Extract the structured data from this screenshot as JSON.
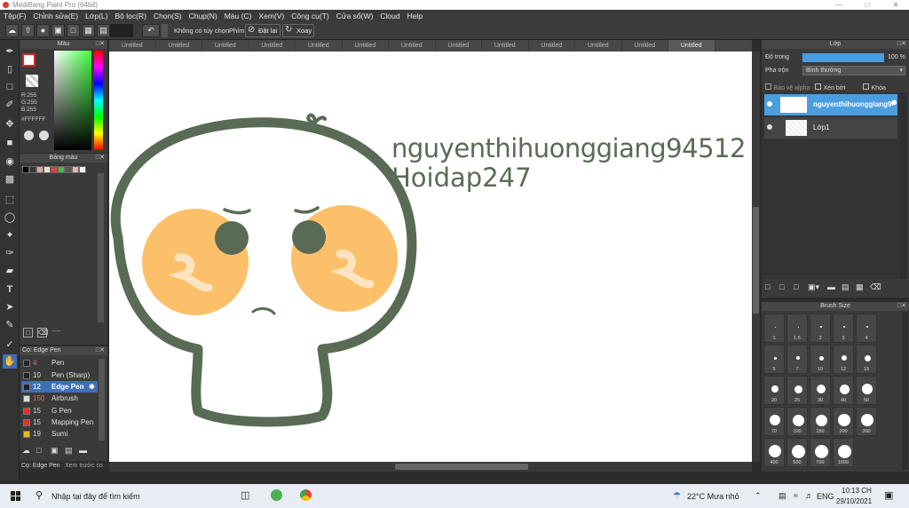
{
  "window": {
    "title": "MediBang Paint Pro (64bit)"
  },
  "menu": [
    "Tệp(F)",
    "Chỉnh sửa(E)",
    "Lớp(L)",
    "Bộ lọc(R)",
    "Chọn(S)",
    "Chụp(N)",
    "Màu (C)",
    "Xem(V)",
    "Công cụ(T)",
    "Cửa sổ(W)",
    "Cloud",
    "Help"
  ],
  "toolbar": {
    "antialias_label": "Không có tùy chọn",
    "key_label": "Phím",
    "reset_label": "Đặt lại",
    "rotate_label": "Xoay"
  },
  "tabs": [
    "Untitled",
    "Untitled",
    "Untitled",
    "Untitled",
    "Untitled",
    "Untitled",
    "Untitled",
    "Untitled",
    "Untitled",
    "Untitled",
    "Untitled",
    "Untitled",
    "Untitled"
  ],
  "color_panel": {
    "title": "Màu",
    "r": "R:255",
    "g": "G:255",
    "b": "B:255",
    "hex": "#FFFFFF"
  },
  "swatch_panel": {
    "title": "Bảng màu",
    "footer": "----"
  },
  "brush_panel": {
    "title": "Cọ: Edge Pen",
    "brushes": [
      {
        "size": "4",
        "name": "Pen",
        "color": "#222222"
      },
      {
        "size": "10",
        "name": "Pen (Sharp)",
        "color": "#222222"
      },
      {
        "size": "12",
        "name": "Edge Pen",
        "color": "#222222",
        "selected": true
      },
      {
        "size": "150",
        "name": "Airbrush",
        "color": "#dddddd"
      },
      {
        "size": "15",
        "name": "G Pen",
        "color": "#e03030"
      },
      {
        "size": "15",
        "name": "Mapping Pen",
        "color": "#e03030"
      },
      {
        "size": "19",
        "name": "Sumi",
        "color": "#e0c020"
      }
    ],
    "tab1": "Cọ: Edge Pen",
    "tab2": "Xem trước co"
  },
  "canvas": {
    "text_line1": "nguyenthihuonggiang94512",
    "text_line2": "Hoidap247",
    "colors": {
      "outline": "#5a6b55",
      "cheek": "#fdc06a",
      "cheek_mark": "#fde4c0",
      "eye": "#5a6b55"
    }
  },
  "layer_panel": {
    "title": "Lớp",
    "opacity_label": "Độ trong",
    "opacity_value": "100 %",
    "opacity": 1.0,
    "blend_label": "Pha trộn",
    "blend_value": "Bình thường",
    "protect_alpha": "Bảo vệ alpha",
    "clipping": "Xén bớt",
    "lock": "Khóa",
    "layers": [
      {
        "name": "nguyenthihuonggiang94512",
        "selected": true
      },
      {
        "name": "Lớp1",
        "selected": false
      }
    ]
  },
  "brush_size_panel": {
    "title": "Brush Size",
    "sizes": [
      "1",
      "1.5",
      "2",
      "3",
      "4",
      "5",
      "7",
      "10",
      "12",
      "15",
      "20",
      "25",
      "30",
      "40",
      "50",
      "70",
      "100",
      "150",
      "200",
      "300",
      "400",
      "500",
      "700",
      "1000"
    ]
  },
  "taskbar": {
    "search_placeholder": "Nhập tại đây để tìm kiếm",
    "weather": "22°C  Mưa nhỏ",
    "lang": "ENG",
    "time": "10:13 CH",
    "date": "29/10/2021"
  }
}
